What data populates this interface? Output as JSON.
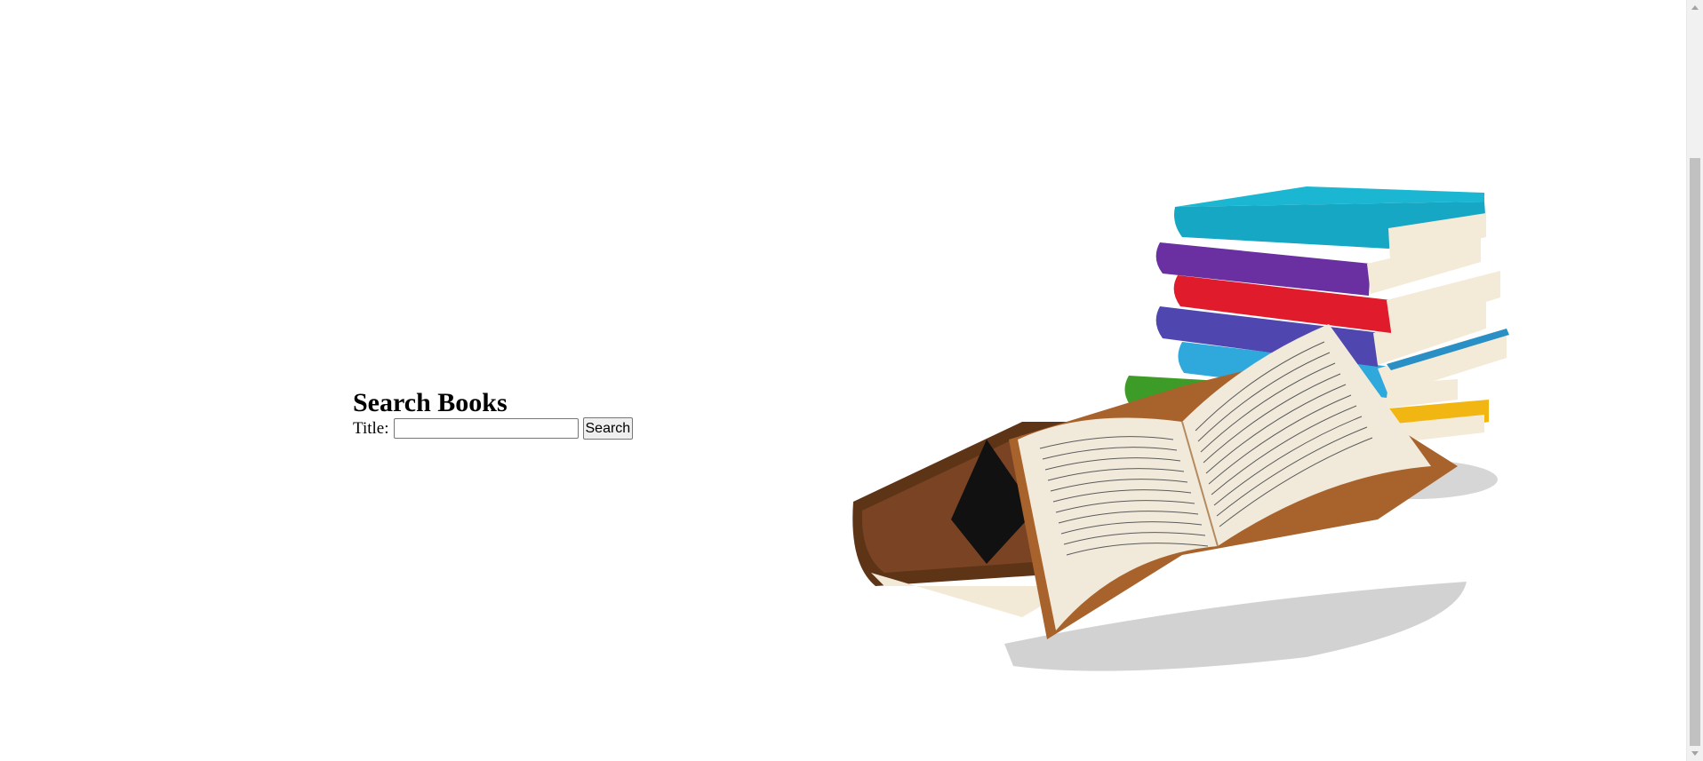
{
  "search": {
    "heading": "Search Books",
    "title_label": "Title:",
    "title_value": "",
    "button_label": "Search"
  },
  "illustration": {
    "subject": "stack-of-books-and-open-book"
  },
  "colors": {
    "background": "#ffffff",
    "scrollbar_track": "#f1f1f1",
    "scrollbar_thumb": "#c1c1c1"
  }
}
